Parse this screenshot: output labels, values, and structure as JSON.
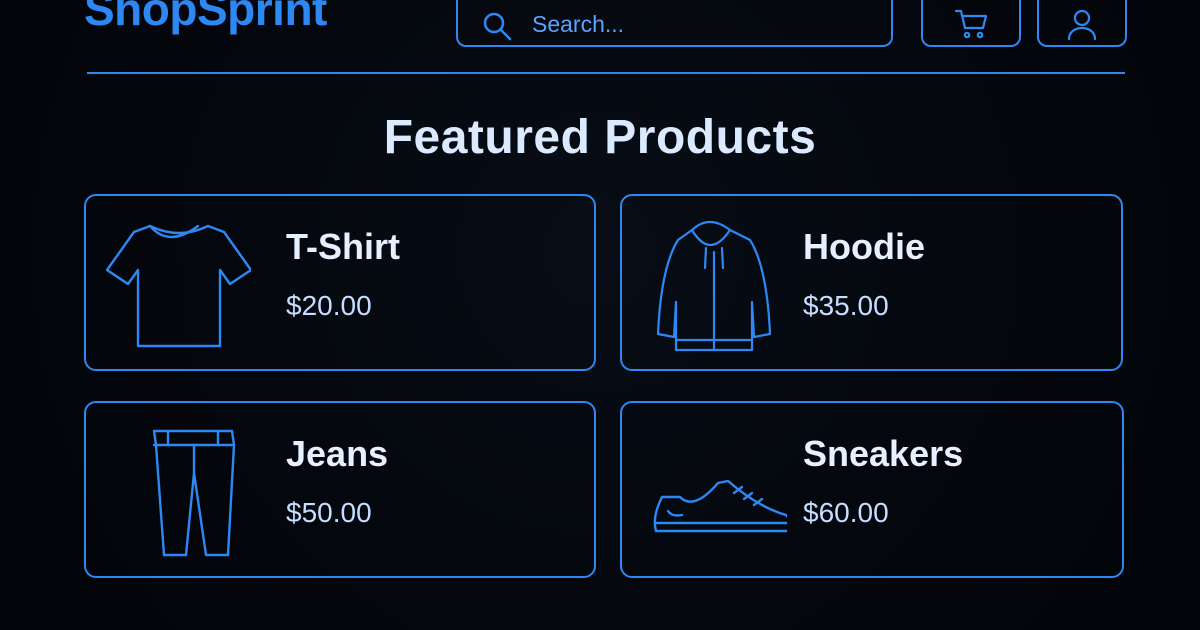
{
  "header": {
    "logo": "ShopSprint",
    "search_placeholder": "Search...",
    "search_icon": "search-icon",
    "cart_icon": "cart-icon",
    "account_icon": "user-icon"
  },
  "main": {
    "section_title": "Featured Products",
    "products": [
      {
        "name": "T-Shirt",
        "price": "$20.00",
        "icon": "tshirt-icon"
      },
      {
        "name": "Hoodie",
        "price": "$35.00",
        "icon": "hoodie-icon"
      },
      {
        "name": "Jeans",
        "price": "$50.00",
        "icon": "jeans-icon"
      },
      {
        "name": "Sneakers",
        "price": "$60.00",
        "icon": "sneaker-icon"
      }
    ]
  },
  "colors": {
    "accent": "#2e88f4",
    "background": "#04070d",
    "heading_text": "#dbeafe",
    "price_text": "#c6ddff"
  }
}
